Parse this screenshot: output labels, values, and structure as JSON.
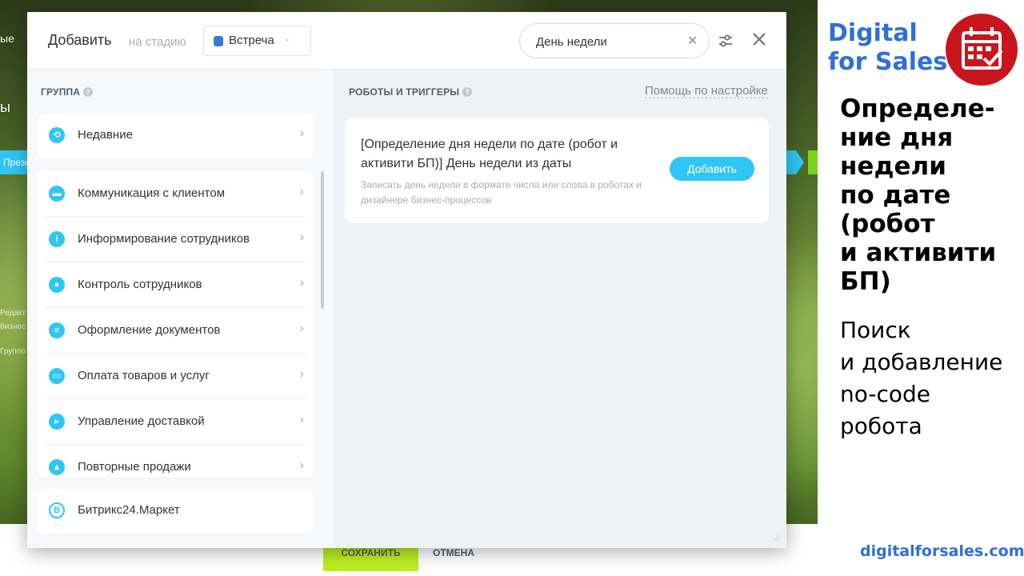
{
  "background": {
    "left_texts": [
      "ые",
      "ы",
      "Презе",
      "Редакт",
      "бизнес",
      "Группо"
    ],
    "save_label": "СОХРАНИТЬ",
    "cancel_label": "ОТМЕНА",
    "colors": {
      "accent_cyan": "#2fc6f6",
      "save_green": "#bbed21"
    }
  },
  "dialog": {
    "title": "Добавить",
    "stage_label": "на стадию",
    "stage_value": "Встреча",
    "stage_caret": "-",
    "search": {
      "value": "День недели",
      "clear": "✕"
    },
    "icons": {
      "settings": "sliders-icon",
      "close": "close-icon"
    },
    "left": {
      "caption": "ГРУППА",
      "help": "?",
      "recent": {
        "label": "Недавние",
        "icon": "history-icon"
      },
      "groups": [
        {
          "label": "Коммуникация с клиентом",
          "icon": "chat-icon"
        },
        {
          "label": "Информирование сотрудников",
          "icon": "info-icon"
        },
        {
          "label": "Контроль сотрудников",
          "icon": "users-icon"
        },
        {
          "label": "Оформление документов",
          "icon": "document-icon"
        },
        {
          "label": "Оплата товаров и услуг",
          "icon": "wallet-icon"
        },
        {
          "label": "Управление доставкой",
          "icon": "truck-icon"
        },
        {
          "label": "Повторные продажи",
          "icon": "cart-icon"
        }
      ],
      "market": {
        "label": "Битрикс24.Маркет",
        "icon": "market-icon"
      }
    },
    "right": {
      "caption": "РОБОТЫ И ТРИГГЕРЫ",
      "help": "?",
      "help_link": "Помощь по настройке",
      "result": {
        "title": "[Определение дня недели по дате (робот и активити БП)] День недели из даты",
        "description": "Записать день недели в формате числа или слова в роботах и дизайнере бизнес-процессов",
        "add_label": "Добавить"
      }
    }
  },
  "promo": {
    "brand_line1": "Digital",
    "brand_line2": "for Sales",
    "logo_icon": "calendar-check-icon",
    "heading": [
      "Определе-",
      "ние дня",
      "недели",
      "по дате",
      "(робот",
      "и активити",
      "БП)"
    ],
    "subheading": [
      "Поиск",
      "и добавление",
      "no-code",
      "робота"
    ],
    "site": "digitalforsales.com",
    "colors": {
      "brand_blue": "#2f6fd6",
      "logo_red": "#c8161d"
    }
  }
}
